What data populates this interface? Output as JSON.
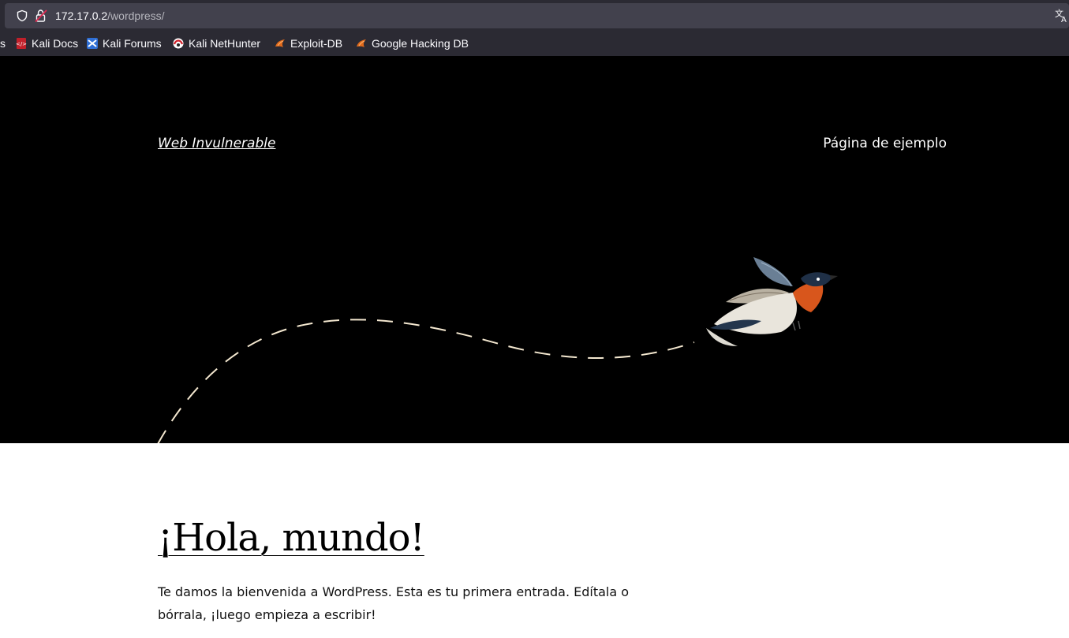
{
  "browser": {
    "url_host": "172.17.0.2",
    "url_path": "/wordpress/",
    "bookmark_clipped_text": "s",
    "bookmarks": [
      {
        "label": "Kali Docs",
        "icon": "kali-docs-icon"
      },
      {
        "label": "Kali Forums",
        "icon": "kali-forums-icon"
      },
      {
        "label": "Kali NetHunter",
        "icon": "kali-nethunter-icon"
      },
      {
        "label": "Exploit-DB",
        "icon": "exploit-db-icon"
      },
      {
        "label": "Google Hacking DB",
        "icon": "google-hacking-db-icon"
      }
    ]
  },
  "site": {
    "title": "Web Invulnerable",
    "nav": [
      {
        "label": "Página de ejemplo"
      }
    ]
  },
  "post": {
    "title": "¡Hola, mundo!",
    "excerpt": "Te damos la bienvenida a WordPress. Esta es tu primera entrada. Edítala o bórrala, ¡luego empieza a escribir!"
  },
  "colors": {
    "chrome_bg": "#2b2a33",
    "urlbar_bg": "#42414d",
    "header_bg": "#000000",
    "dashed_path": "#f4e8d0",
    "bird_breast": "#d8561c"
  }
}
